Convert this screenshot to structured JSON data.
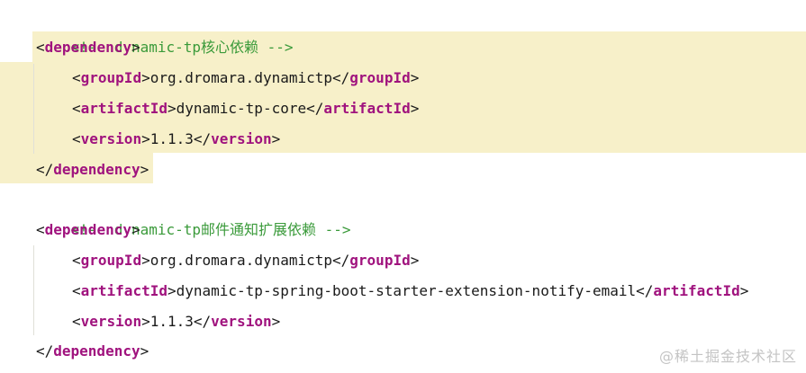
{
  "editor": {
    "lines": [
      {
        "comment": "<!-- dynamic-tp核心依赖 -->"
      },
      {
        "open": "<",
        "tag": "dependency",
        "close": ">"
      },
      {
        "open": "<",
        "tag": "groupId",
        "close": ">",
        "value": "org.dromara.dynamictp",
        "end_open": "</",
        "end_tag": "groupId",
        "end_close": ">"
      },
      {
        "open": "<",
        "tag": "artifactId",
        "close": ">",
        "value": "dynamic-tp-core",
        "end_open": "</",
        "end_tag": "artifactId",
        "end_close": ">"
      },
      {
        "open": "<",
        "tag": "version",
        "close": ">",
        "value": "1.1.3",
        "end_open": "</",
        "end_tag": "version",
        "end_close": ">"
      },
      {
        "open": "</",
        "tag": "dependency",
        "close": ">"
      },
      {
        "comment": "<!-- dynamic-tp邮件通知扩展依赖 -->"
      },
      {
        "open": "<",
        "tag": "dependency",
        "close": ">"
      },
      {
        "open": "<",
        "tag": "groupId",
        "close": ">",
        "value": "org.dromara.dynamictp",
        "end_open": "</",
        "end_tag": "groupId",
        "end_close": ">"
      },
      {
        "open": "<",
        "tag": "artifactId",
        "close": ">",
        "value": "dynamic-tp-spring-boot-starter-extension-notify-email",
        "end_open": "</",
        "end_tag": "artifactId",
        "end_close": ">"
      },
      {
        "open": "<",
        "tag": "version",
        "close": ">",
        "value": "1.1.3",
        "end_open": "</",
        "end_tag": "version",
        "end_close": ">"
      },
      {
        "open": "</",
        "tag": "dependency",
        "close": ">"
      }
    ],
    "highlight_color": "#f7f0c9",
    "tag_color": "#a0137e",
    "comment_color": "#3a9a3a"
  },
  "watermark": "@稀土掘金技术社区"
}
